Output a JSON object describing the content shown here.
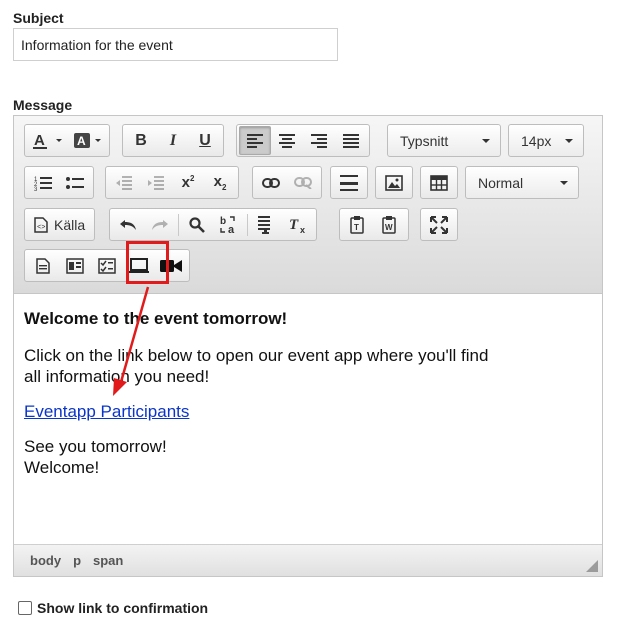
{
  "subject": {
    "label": "Subject",
    "value": "Information for the event"
  },
  "message": {
    "label": "Message"
  },
  "toolbar": {
    "font_family": "Typsnitt",
    "font_size": "14px",
    "format": "Normal",
    "source_label": "Källa"
  },
  "content": {
    "title": "Welcome to the event tomorrow!",
    "line1": "Click on the link below to open our event app where you'll find",
    "line2": "all information you need!",
    "link": "Eventapp Participants",
    "see_you": "See you tomorrow!",
    "welcome": "Welcome!"
  },
  "statusbar": {
    "path": [
      "body",
      "p",
      "span"
    ]
  },
  "checkbox": {
    "label": "Show link to confirmation",
    "checked": false
  },
  "annotation": {
    "color": "#e11b1b"
  }
}
